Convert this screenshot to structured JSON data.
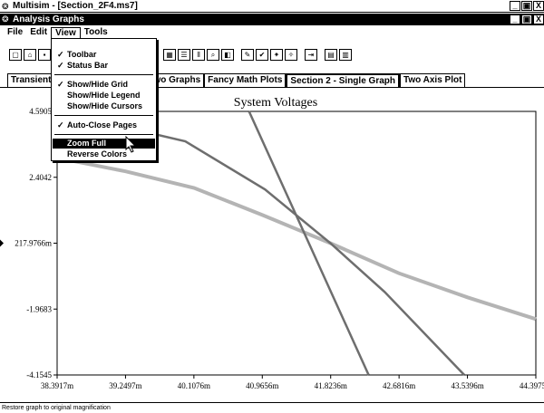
{
  "app": {
    "title": "Multisim - [Section_2F4.ms7]",
    "subwindow_title": "Analysis Graphs",
    "min_glyph": "_",
    "restore_glyph": "▣",
    "close_glyph": "X"
  },
  "menubar": {
    "items": [
      {
        "label": "File"
      },
      {
        "label": "Edit"
      },
      {
        "label": "View"
      },
      {
        "label": "Tools"
      }
    ]
  },
  "view_menu": {
    "items": [
      {
        "label": "Toolbar",
        "checked": true
      },
      {
        "label": "Status Bar",
        "checked": true
      },
      {
        "label": "Show/Hide Grid",
        "checked": true
      },
      {
        "label": "Show/Hide Legend",
        "checked": false
      },
      {
        "label": "Show/Hide Cursors",
        "checked": false
      },
      {
        "label": "Auto-Close Pages",
        "checked": true
      },
      {
        "label": "Zoom Full",
        "checked": false,
        "highlighted": true
      },
      {
        "label": "Reverse Colors",
        "checked": false
      }
    ],
    "check_glyph": "✓"
  },
  "tabs": [
    {
      "label": "Transient"
    },
    {
      "label": "wo Graphs"
    },
    {
      "label": "Fancy Math Plots"
    },
    {
      "label": "Section 2 - Single Graph",
      "selected": true
    },
    {
      "label": "Two Axis Plot"
    }
  ],
  "status_bar": {
    "text": "Restore graph to original magnification"
  },
  "chart_data": {
    "type": "line",
    "title": "System Voltages",
    "xlabel": "",
    "ylabel": "",
    "x_tick_labels": [
      "38.3917m",
      "39.2497m",
      "40.1076m",
      "40.9656m",
      "41.8236m",
      "42.6816m",
      "43.5396m",
      "44.3975m"
    ],
    "y_tick_labels": [
      "4.5905",
      "2.4042",
      "217.9766m",
      "-1.9683",
      "-4.1545"
    ],
    "xlim": [
      38.3917,
      44.3975
    ],
    "ylim": [
      -4.1545,
      4.5905
    ],
    "grid": false,
    "colors": {
      "light": "#b4b4b4",
      "dark": "#6e6e6e"
    },
    "series": [
      {
        "color": "#b4b4b4",
        "x": [
          38.3917,
          39.25,
          40.11,
          40.97,
          41.82,
          42.68,
          43.54,
          44.3975
        ],
        "y": [
          3.05,
          2.6,
          2.05,
          1.15,
          0.218,
          -0.78,
          -1.58,
          -2.3
        ]
      },
      {
        "color": "#6e6e6e",
        "x": [
          38.3917,
          40.0,
          41.0,
          41.82,
          42.5,
          43.5
        ],
        "y": [
          4.5905,
          3.6,
          2.0,
          0.218,
          -1.4,
          -4.1545
        ]
      },
      {
        "color": "#6e6e6e",
        "x": [
          40.8,
          42.3
        ],
        "y": [
          4.5905,
          -4.1545
        ]
      }
    ]
  }
}
